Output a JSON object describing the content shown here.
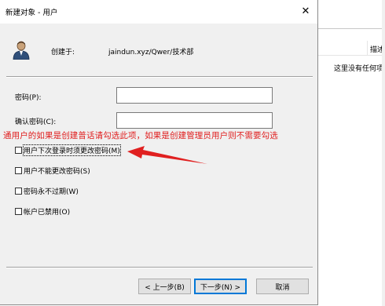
{
  "background_window": {
    "column_header": "描述",
    "empty_text": "这里没有任何项"
  },
  "dialog": {
    "title": "新建对象 - 用户",
    "close_glyph": "✕",
    "created_in_label": "创建于:",
    "created_in_value": "jaindun.xyz/Qwer/技术部"
  },
  "form": {
    "password_label": "密码(P):",
    "password_value": "",
    "confirm_label": "确认密码(C):",
    "confirm_value": ""
  },
  "annotation": "通用户的如果是创建普话请勾选此项，如果是创建管理员用户则不需要勾选",
  "options": [
    {
      "label": "用户下次登录时须更改密码(M)",
      "checked": false
    },
    {
      "label": "用户不能更改密码(S)",
      "checked": false
    },
    {
      "label": "密码永不过期(W)",
      "checked": false
    },
    {
      "label": "帐户已禁用(O)",
      "checked": false
    }
  ],
  "buttons": {
    "back": "< 上一步(B)",
    "next": "下一步(N) >",
    "cancel": "取消"
  },
  "colors": {
    "annotation": "#e02020",
    "dialog_bg": "#f0f0f0",
    "default_button_border": "#0078d7"
  }
}
